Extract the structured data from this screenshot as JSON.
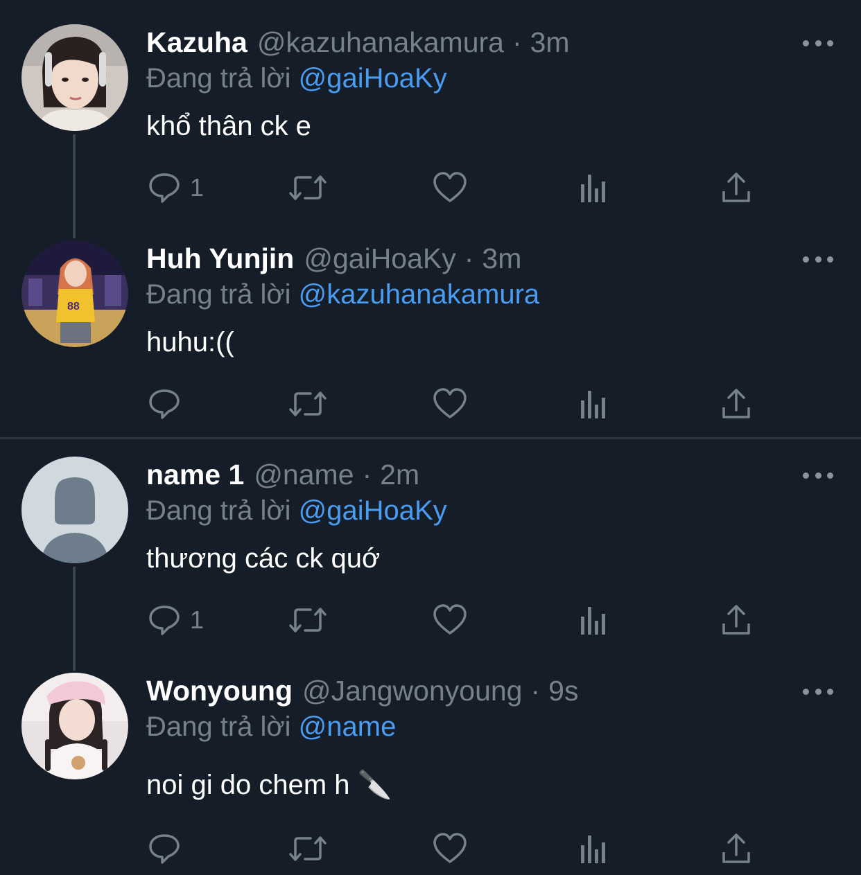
{
  "colors": {
    "background": "#151d28",
    "mention": "#4a9cf0",
    "muted": "#77818c",
    "divider": "#2b343f"
  },
  "icons": {
    "reply": "speech-bubble-icon",
    "retweet": "retweet-arrows-icon",
    "like": "heart-icon",
    "views": "bar-chart-icon",
    "share": "upload-arrow-icon",
    "more": "three-dots-icon"
  },
  "tweets": [
    {
      "name": "Kazuha",
      "handle": "@kazuhanakamura",
      "separator": "·",
      "time": "3m",
      "reply_prefix": "Đang trả lời",
      "reply_to": "@gaiHoaKy",
      "text": "khổ thân ck e",
      "reply_count": "1"
    },
    {
      "name": "Huh Yunjin",
      "handle": "@gaiHoaKy",
      "separator": "·",
      "time": "3m",
      "reply_prefix": "Đang trả lời",
      "reply_to": "@kazuhanakamura",
      "text": "huhu:((",
      "reply_count": ""
    },
    {
      "name": "name 1",
      "handle": "@name",
      "separator": "·",
      "time": "2m",
      "reply_prefix": "Đang trả lời",
      "reply_to": "@gaiHoaKy",
      "text": "thương các ck quớ",
      "reply_count": "1"
    },
    {
      "name": "Wonyoung",
      "handle": "@Jangwonyoung",
      "separator": "·",
      "time": "9s",
      "reply_prefix": "Đang trả lời",
      "reply_to": "@name",
      "text": "noi gi do chem h 🔪",
      "reply_count": ""
    }
  ]
}
